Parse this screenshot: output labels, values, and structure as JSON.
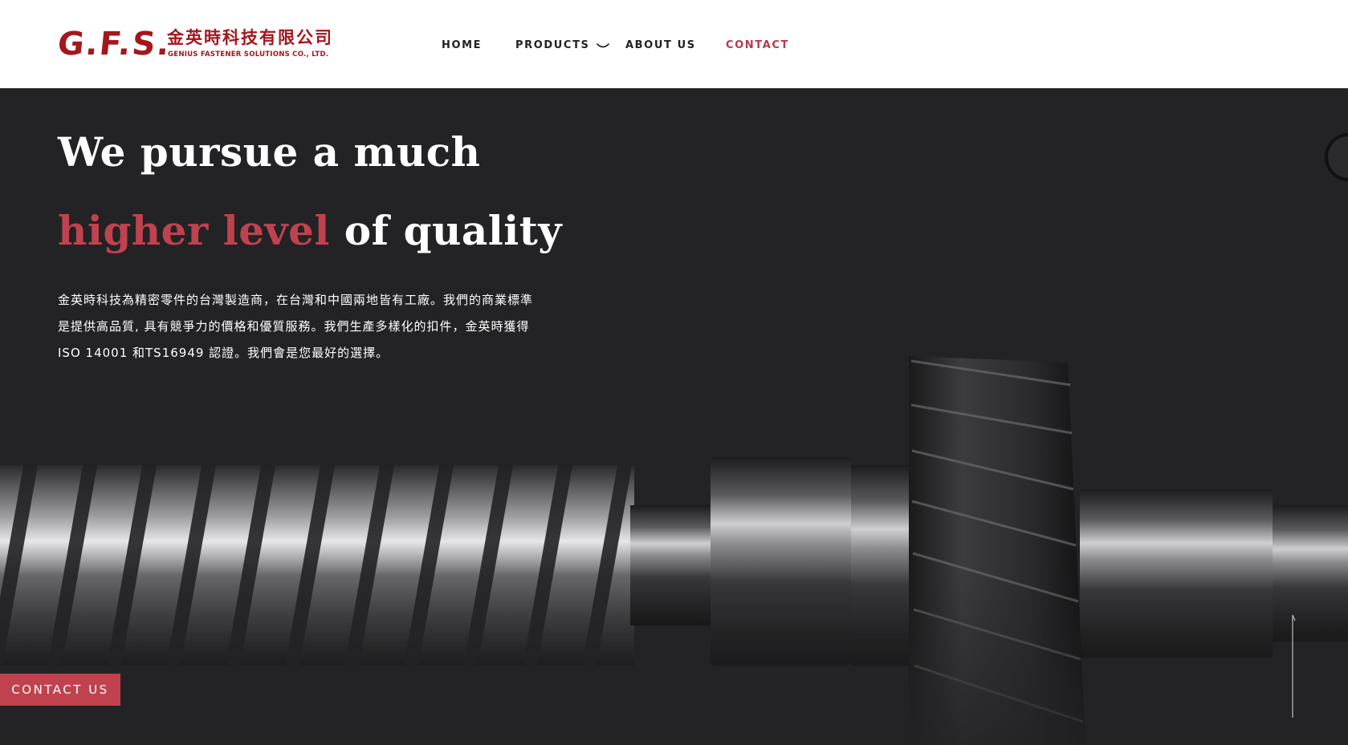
{
  "brand": {
    "mark": "G.F.S.",
    "name_cn": "金英時科技有限公司",
    "name_en": "GENIUS FASTENER SOLUTIONS CO., LTD.",
    "color": "#a3171d"
  },
  "nav": {
    "items": [
      {
        "label": "HOME"
      },
      {
        "label": "PRODUCTS",
        "icon": "chevron-down-icon"
      },
      {
        "label": "ABOUT US"
      },
      {
        "label": "CONTACT",
        "active": true
      }
    ],
    "active_color": "#b9374b"
  },
  "hero": {
    "headline_line1": "We pursue a much",
    "headline_accent": "higher level",
    "headline_rest": " of quality",
    "intro": "金英時科技為精密零件的台灣製造商，在台灣和中國兩地皆有工廠。我們的商業標準是提供高品質, 具有競爭力的價格和優質服務。我們生產多樣化的扣件，金英時獲得 ISO 14001 和TS16949 認證。我們會是您最好的選擇。",
    "accent_color": "#c0424f",
    "background_color": "#232325"
  },
  "cta": {
    "label": "CONTACT US"
  }
}
